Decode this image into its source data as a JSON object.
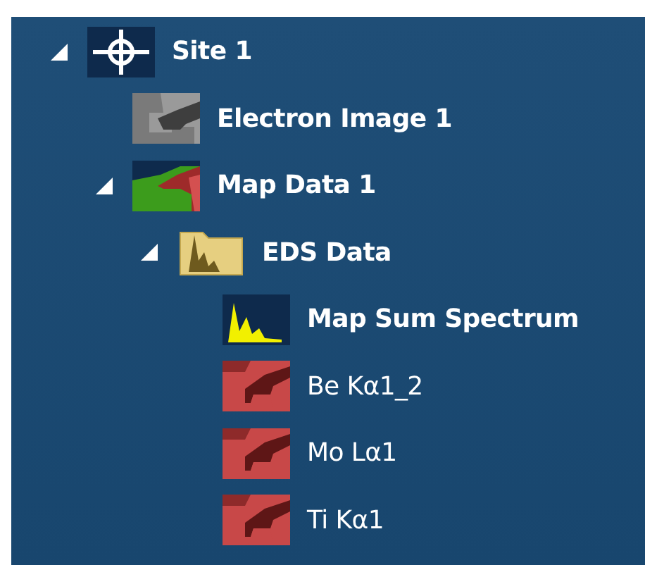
{
  "tree": [
    {
      "label": "Site 1",
      "kind": "site",
      "expanded": true,
      "children": [
        {
          "label": "Electron Image 1",
          "kind": "electron-image"
        },
        {
          "label": "Map Data 1",
          "kind": "map-data",
          "expanded": true,
          "children": [
            {
              "label": "EDS Data",
              "kind": "folder",
              "expanded": true,
              "children": [
                {
                  "label": "Map Sum Spectrum",
                  "kind": "spectrum"
                },
                {
                  "label": "Be Kα1_2",
                  "kind": "element-map"
                },
                {
                  "label": "Mo Lα1",
                  "kind": "element-map"
                },
                {
                  "label": "Ti Kα1",
                  "kind": "element-map"
                }
              ]
            }
          ]
        }
      ]
    }
  ]
}
